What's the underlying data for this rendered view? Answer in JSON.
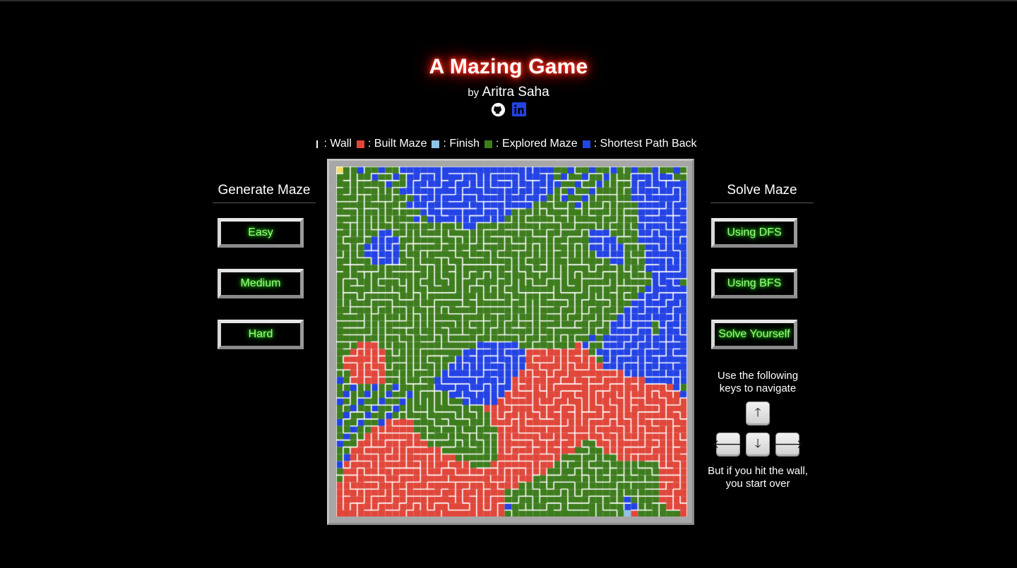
{
  "header": {
    "title": "A Mazing Game",
    "by": "by",
    "author": "Aritra Saha",
    "icons": [
      "github-icon",
      "linkedin-icon"
    ]
  },
  "legend": {
    "wall": ": Wall",
    "built": ": Built Maze",
    "finish": ": Finish",
    "explored": ": Explored Maze",
    "shortest": ": Shortest Path Back"
  },
  "generate": {
    "title": "Generate Maze",
    "easy": "Easy",
    "medium": "Medium",
    "hard": "Hard"
  },
  "solve": {
    "title": "Solve Maze",
    "dfs": "Using DFS",
    "bfs": "Using BFS",
    "yourself": "Solve Yourself",
    "instructions": "Use the following keys to navigate",
    "warning": "But if you hit the wall, you start over",
    "keys": {
      "up": "🡑",
      "left": "🡐",
      "down": "🡓",
      "right": "🡒"
    }
  },
  "colors": {
    "background": "#000000",
    "wall": "#ffffff",
    "built": "#e0473a",
    "finish": "#8fc3e8",
    "explored": "#3e7d1e",
    "shortest": "#2343e4",
    "start": "#f3dc66",
    "neon_green": "#9bff8a",
    "neon_red": "#ff2a1a"
  }
}
